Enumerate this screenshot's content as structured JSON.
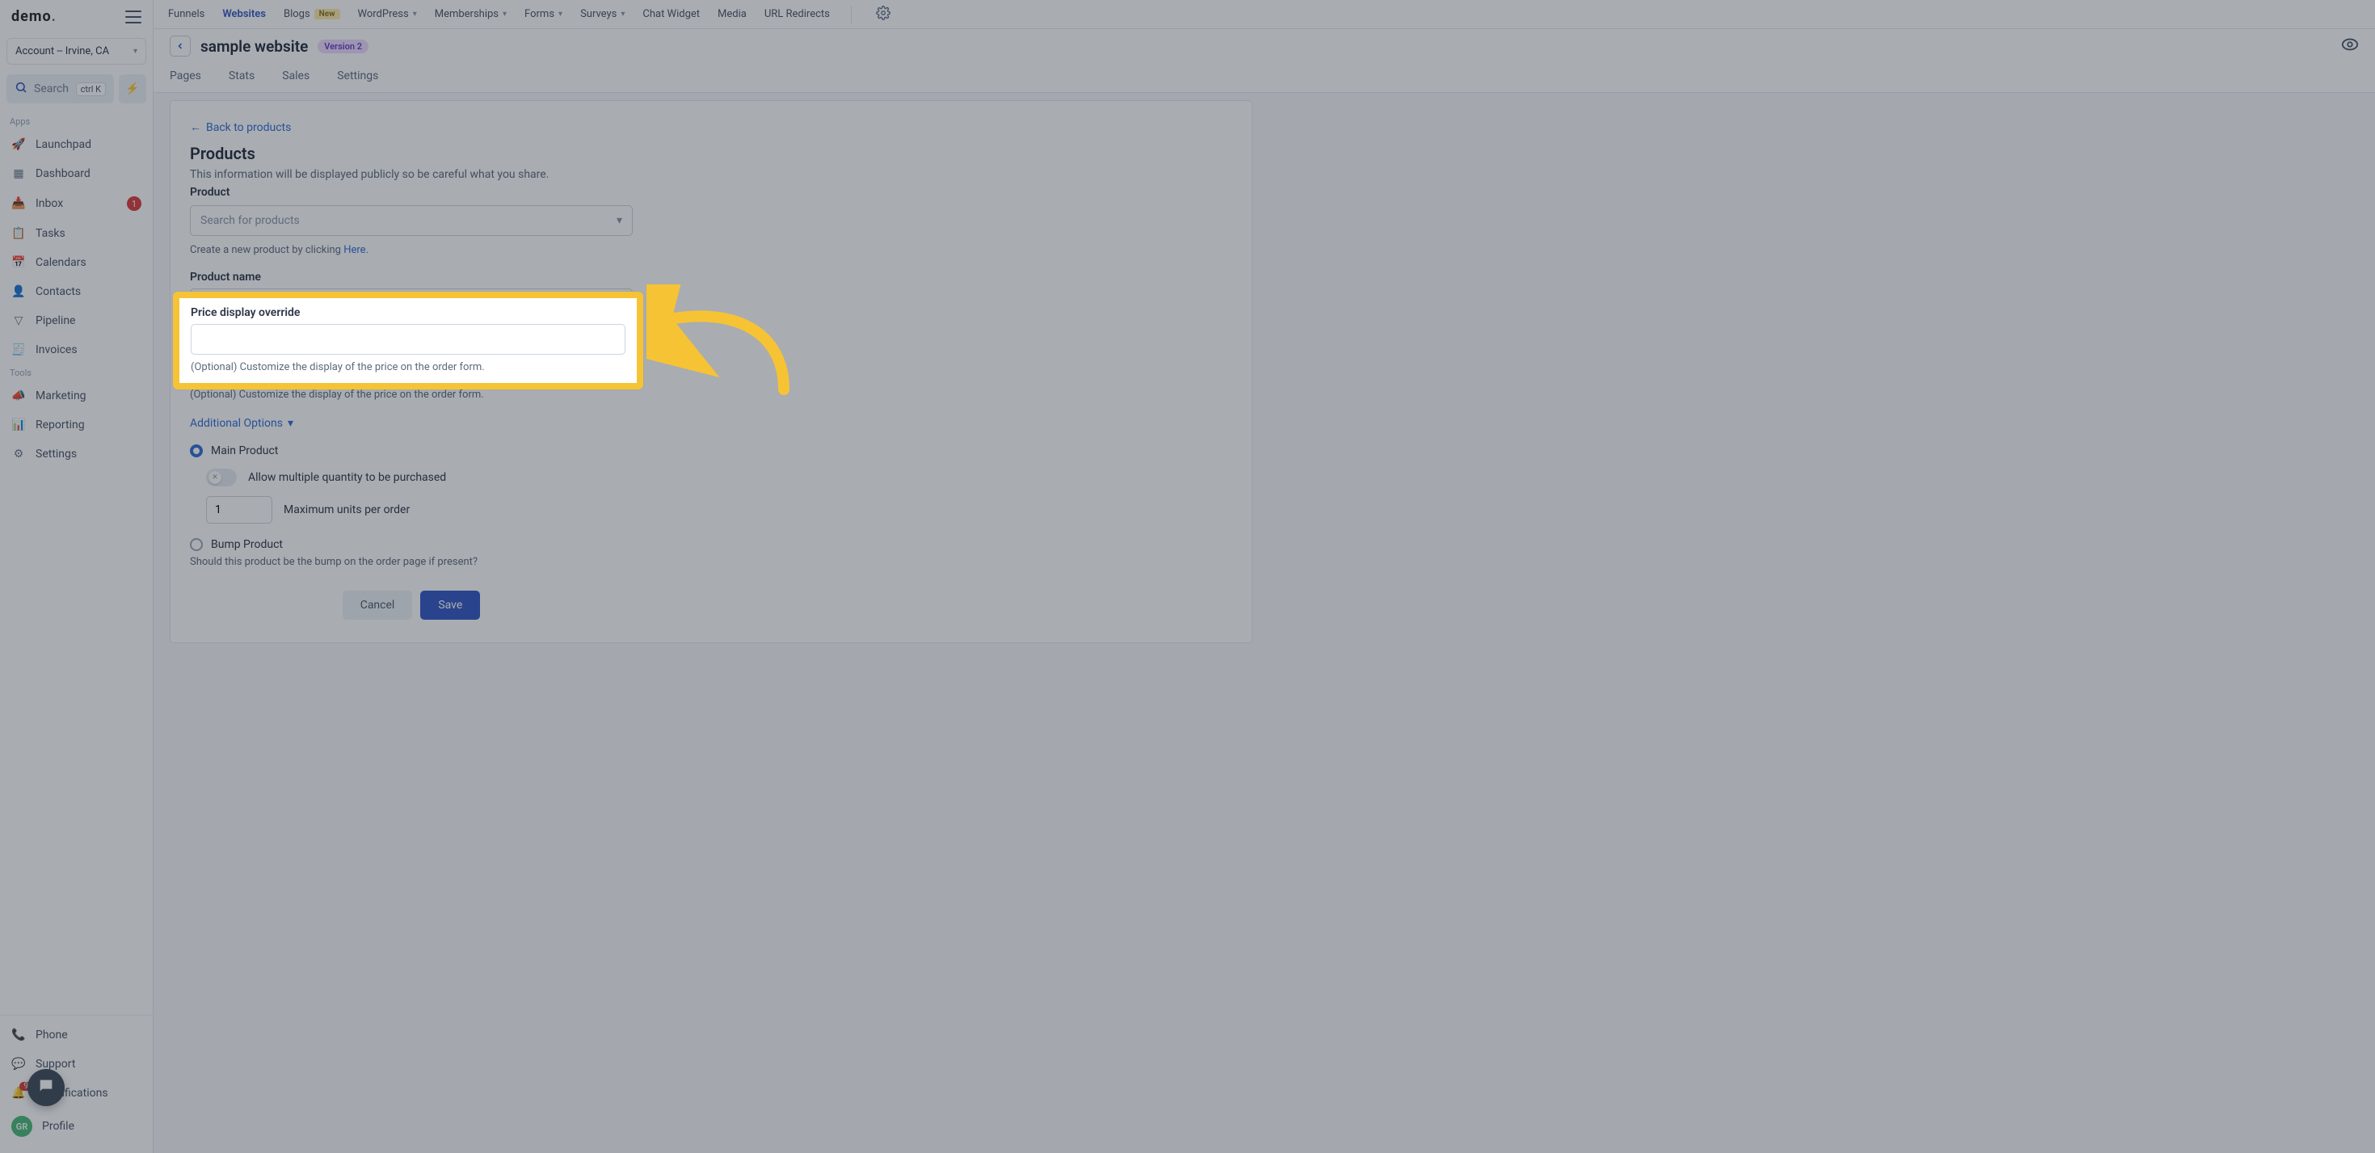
{
  "brand": {
    "logo_text": "demo",
    "logo_dot": "."
  },
  "account_selector": {
    "label": "Account -- Irvine, CA"
  },
  "search": {
    "label": "Search",
    "shortcut": "ctrl K"
  },
  "side_sections": {
    "apps": "Apps",
    "tools": "Tools"
  },
  "side_apps": [
    {
      "label": "Launchpad",
      "icon": "🚀"
    },
    {
      "label": "Dashboard",
      "icon": "▦"
    },
    {
      "label": "Inbox",
      "icon": "📥",
      "badge": "1"
    },
    {
      "label": "Tasks",
      "icon": "📋"
    },
    {
      "label": "Calendars",
      "icon": "📅"
    },
    {
      "label": "Contacts",
      "icon": "👤"
    },
    {
      "label": "Pipeline",
      "icon": "▽"
    },
    {
      "label": "Invoices",
      "icon": "🧾"
    }
  ],
  "side_tools": [
    {
      "label": "Marketing",
      "icon": "📣"
    },
    {
      "label": "Reporting",
      "icon": "📊"
    },
    {
      "label": "Settings",
      "icon": "⚙"
    }
  ],
  "side_footer": [
    {
      "label": "Phone",
      "icon": "📞"
    },
    {
      "label": "Support",
      "icon": "💬"
    },
    {
      "label": "Notifications",
      "icon": "🔔",
      "badge": "9"
    },
    {
      "label": "Profile",
      "icon": "avatar",
      "initials": "GR"
    }
  ],
  "topnav": {
    "items": [
      {
        "label": "Funnels"
      },
      {
        "label": "Websites",
        "active": true
      },
      {
        "label": "Blogs",
        "pill": "New"
      },
      {
        "label": "WordPress",
        "chev": true
      },
      {
        "label": "Memberships",
        "chev": true
      },
      {
        "label": "Forms",
        "chev": true
      },
      {
        "label": "Surveys",
        "chev": true
      },
      {
        "label": "Chat Widget"
      },
      {
        "label": "Media"
      },
      {
        "label": "URL Redirects"
      }
    ]
  },
  "page": {
    "site_title": "sample website",
    "version": "Version 2",
    "tabs": [
      "Pages",
      "Stats",
      "Sales",
      "Settings"
    ]
  },
  "form": {
    "back": "Back to products",
    "heading": "Products",
    "sub": "This information will be displayed publicly so be careful what you share.",
    "product_label": "Product",
    "product_placeholder": "Search for products",
    "create_hint_pre": "Create a new product by clicking ",
    "create_hint_link": "Here.",
    "name_label": "Product name",
    "name_value": "",
    "price_label": "Price display override",
    "price_value": "",
    "price_hint": "(Optional) Customize the display of the price on the order form.",
    "additional": "Additional Options",
    "main_product": "Main Product",
    "allow_multi": "Allow multiple quantity to be purchased",
    "max_units_value": "1",
    "max_units_label": "Maximum units per order",
    "bump_product": "Bump Product",
    "bump_hint": "Should this product be the bump on the order page if present?",
    "cancel": "Cancel",
    "save": "Save"
  }
}
